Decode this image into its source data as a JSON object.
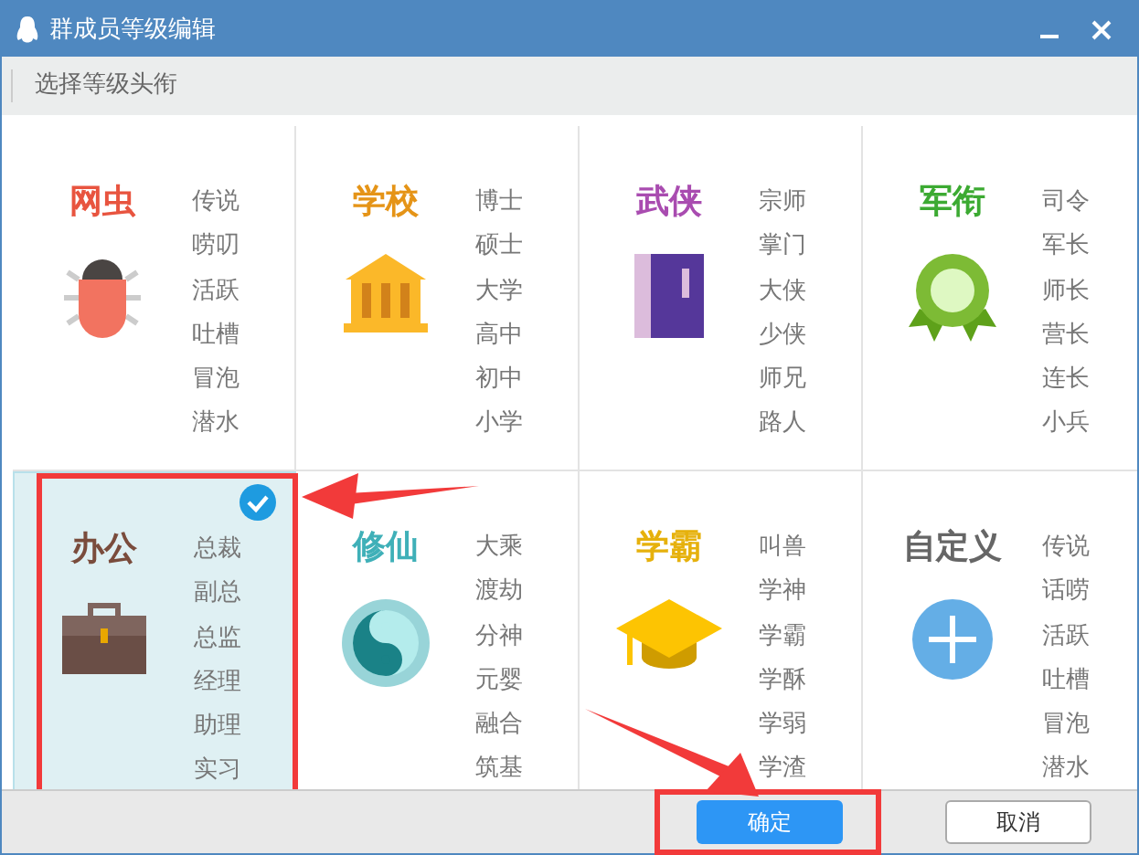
{
  "window": {
    "title": "群成员等级编辑"
  },
  "toolbar": {
    "label": "选择等级头衔"
  },
  "cards": [
    {
      "title": "网虫",
      "color": "#e8543f",
      "kind": "bug",
      "selected": false,
      "highlighted": false,
      "items": [
        "传说",
        "唠叨",
        "活跃",
        "吐槽",
        "冒泡",
        "潜水"
      ]
    },
    {
      "title": "学校",
      "color": "#e59417",
      "kind": "building",
      "selected": false,
      "highlighted": false,
      "items": [
        "博士",
        "硕士",
        "大学",
        "高中",
        "初中",
        "小学"
      ]
    },
    {
      "title": "武侠",
      "color": "#a94cb0",
      "kind": "book",
      "selected": false,
      "highlighted": false,
      "items": [
        "宗师",
        "掌门",
        "大侠",
        "少侠",
        "师兄",
        "路人"
      ]
    },
    {
      "title": "军衔",
      "color": "#3caa32",
      "kind": "medal",
      "selected": false,
      "highlighted": false,
      "items": [
        "司令",
        "军长",
        "师长",
        "营长",
        "连长",
        "小兵"
      ]
    },
    {
      "title": "办公",
      "color": "#7a4c3c",
      "kind": "briefcase",
      "selected": true,
      "highlighted": true,
      "items": [
        "总裁",
        "副总",
        "总监",
        "经理",
        "助理",
        "实习"
      ]
    },
    {
      "title": "修仙",
      "color": "#3fb0b8",
      "kind": "yinyang",
      "selected": false,
      "highlighted": false,
      "items": [
        "大乘",
        "渡劫",
        "分神",
        "元婴",
        "融合",
        "筑基"
      ]
    },
    {
      "title": "学霸",
      "color": "#e6b10c",
      "kind": "cap",
      "selected": false,
      "highlighted": false,
      "items": [
        "叫兽",
        "学神",
        "学霸",
        "学酥",
        "学弱",
        "学渣"
      ]
    },
    {
      "title": "自定义",
      "color": "#666666",
      "kind": "plus",
      "selected": false,
      "highlighted": false,
      "items": [
        "传说",
        "话唠",
        "活跃",
        "吐槽",
        "冒泡",
        "潜水"
      ]
    }
  ],
  "buttons": [
    {
      "label": "确定",
      "kind": "primary",
      "highlighted": true
    },
    {
      "label": "取消",
      "kind": "secondary",
      "highlighted": false
    }
  ],
  "annotations": [
    {
      "kind": "arrow"
    },
    {
      "kind": "arrow"
    }
  ]
}
